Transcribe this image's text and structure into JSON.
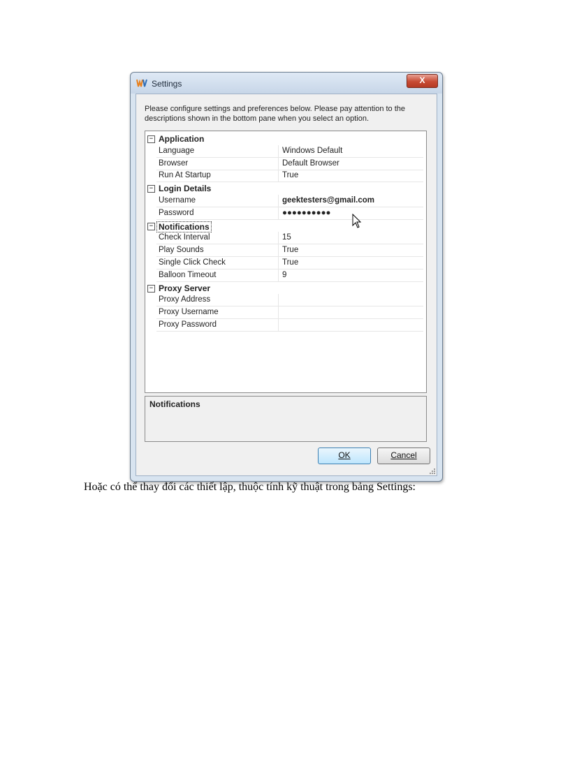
{
  "window": {
    "title": "Settings",
    "close_label": "X",
    "intro_text": "Please configure settings and preferences below. Please pay attention to the descriptions shown in the bottom pane when you select an option."
  },
  "property_grid": {
    "categories": [
      {
        "name": "Application",
        "properties": [
          {
            "name": "Language",
            "value": "Windows Default"
          },
          {
            "name": "Browser",
            "value": "Default Browser"
          },
          {
            "name": "Run At Startup",
            "value": "True"
          }
        ]
      },
      {
        "name": "Login Details",
        "properties": [
          {
            "name": "Username",
            "value": "geektesters@gmail.com"
          },
          {
            "name": "Password",
            "value": "●●●●●●●●●●"
          }
        ]
      },
      {
        "name": "Notifications",
        "properties": [
          {
            "name": "Check Interval",
            "value": "15"
          },
          {
            "name": "Play Sounds",
            "value": "True"
          },
          {
            "name": "Single Click Check",
            "value": "True"
          },
          {
            "name": "Balloon Timeout",
            "value": "9"
          }
        ]
      },
      {
        "name": "Proxy Server",
        "properties": [
          {
            "name": "Proxy Address",
            "value": ""
          },
          {
            "name": "Proxy Username",
            "value": ""
          },
          {
            "name": "Proxy Password",
            "value": ""
          }
        ]
      }
    ],
    "collapse_glyph": "−"
  },
  "description_pane": {
    "title": "Notifications"
  },
  "buttons": {
    "ok_label": "OK",
    "cancel_label": "Cancel"
  },
  "caption": "Hoặc có thể thay đổi các thiết lập, thuộc tính kỹ thuật trong bảng Settings:",
  "colors": {
    "close_button": "#c74a33",
    "icon_orange": "#e8801c",
    "icon_blue": "#2f6db5"
  }
}
